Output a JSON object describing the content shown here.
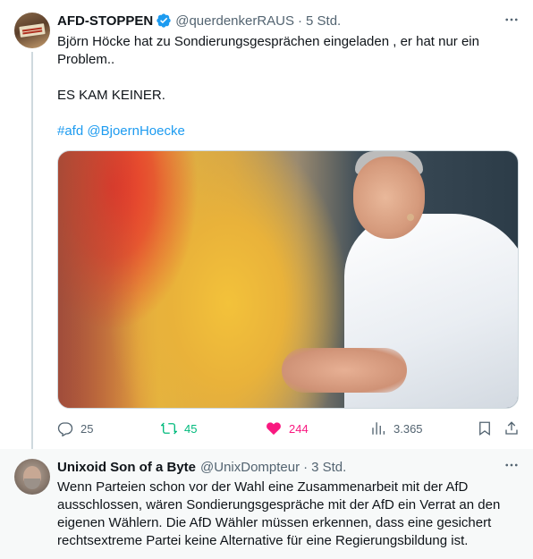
{
  "tweet": {
    "author_name": "AFD-STOPPEN",
    "handle": "@querdenkerRAUS",
    "separator": "·",
    "time": "5 Std.",
    "text_line1": "Björn Höcke hat  zu Sondierungsgesprächen eingeladen , er hat nur ein",
    "text_line2": "Problem..",
    "text_line3": "ES KAM KEINER.",
    "hashtag": "#afd",
    "mention": "@BjoernHoecke",
    "stats": {
      "replies": "25",
      "retweets": "45",
      "likes": "244",
      "views": "3.365"
    }
  },
  "reply": {
    "author_name": "Unixoid Son of a Byte",
    "handle": "@UnixDompteur",
    "separator": "·",
    "time": "3 Std.",
    "line1": "Wenn Parteien schon vor der Wahl eine Zusammenarbeit mit der AfD",
    "line2": "ausschlossen, wären Sondierungsgespräche mit der AfD ein Verrat an den",
    "line3": "eigenen Wählern. Die AfD Wähler müssen erkennen, dass eine gesichert",
    "line4": "rechtsextreme Partei keine Alternative für eine Regierungsbildung ist."
  },
  "colors": {
    "link": "#1d9bf0",
    "retweet": "#00ba7c",
    "like": "#f91880",
    "secondary_text": "#536471"
  },
  "icons": [
    "more-icon",
    "verified-icon",
    "reply-icon",
    "retweet-icon",
    "like-icon",
    "views-icon",
    "bookmark-icon",
    "share-icon"
  ]
}
